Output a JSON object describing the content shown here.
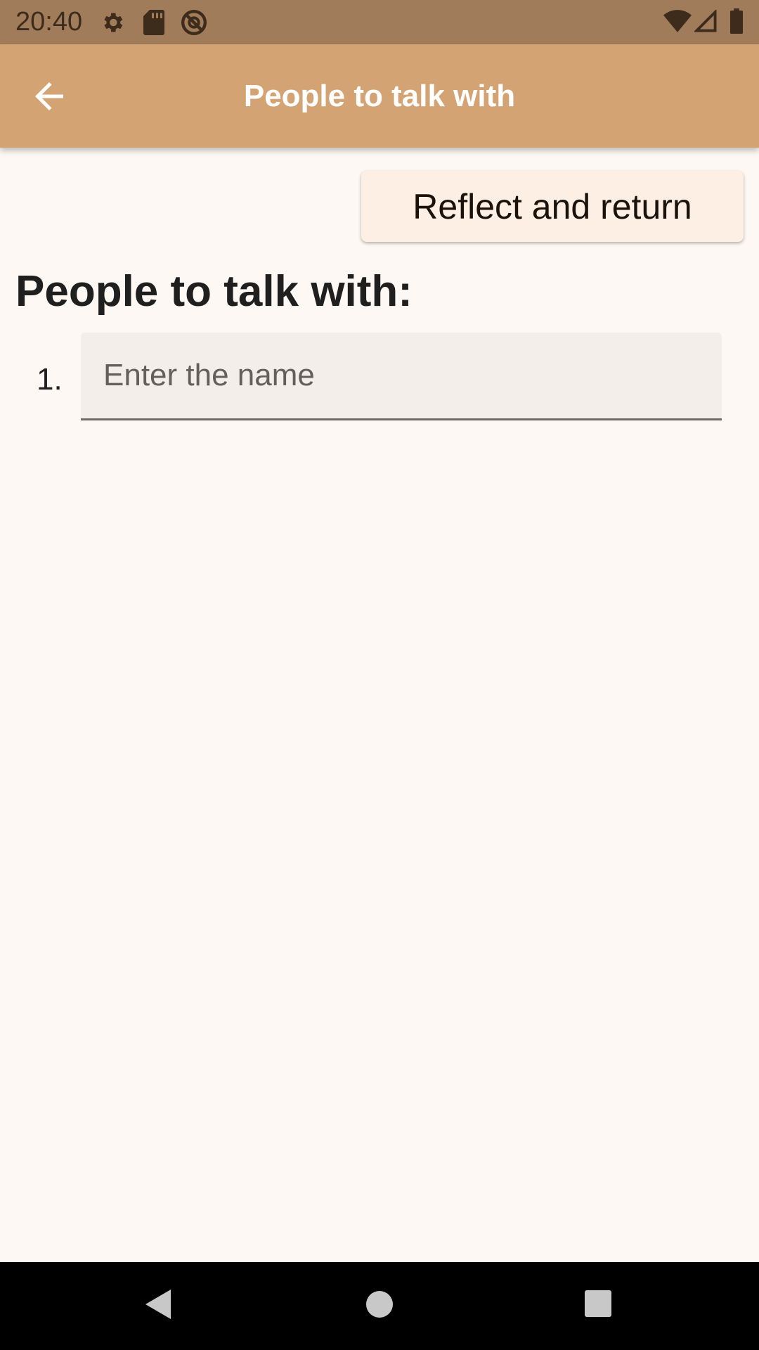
{
  "status_bar": {
    "time": "20:40",
    "icons": [
      "gear-icon",
      "sd-card-icon",
      "no-sign-icon",
      "wifi-icon",
      "signal-icon",
      "battery-icon"
    ]
  },
  "app_bar": {
    "title": "People to talk with",
    "back_icon": "arrow-left-icon"
  },
  "actions": {
    "reflect_label": "Reflect and return"
  },
  "main": {
    "section_title": "People to talk with:",
    "list": [
      {
        "number": "1.",
        "value": "",
        "placeholder": "Enter the name"
      }
    ]
  },
  "nav_bar": {
    "icons": [
      "back-triangle-icon",
      "home-circle-icon",
      "recents-square-icon"
    ]
  },
  "colors": {
    "status_bar": "#a07c5a",
    "app_bar": "#d4a373",
    "background": "#fdf8f3",
    "button": "#fdefe3",
    "input_fill": "#f3eee9"
  }
}
